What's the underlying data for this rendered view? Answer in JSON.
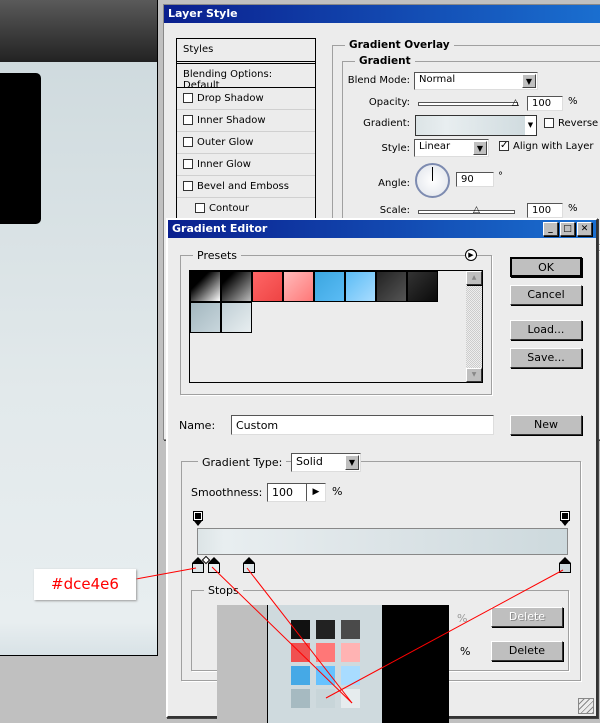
{
  "canvas": {
    "colors": {
      "top_bar": "#2a2a2a",
      "bg": "#dce4e6"
    }
  },
  "layer_style": {
    "title": "Layer Style",
    "styles_header": "Styles",
    "blending": "Blending Options: Default",
    "items": [
      {
        "label": "Drop Shadow",
        "checked": false
      },
      {
        "label": "Inner Shadow",
        "checked": false
      },
      {
        "label": "Outer Glow",
        "checked": false
      },
      {
        "label": "Inner Glow",
        "checked": false
      },
      {
        "label": "Bevel and Emboss",
        "checked": false
      },
      {
        "label": "Contour",
        "checked": false
      }
    ],
    "section": "Gradient Overlay",
    "subsection": "Gradient",
    "blend_mode_label": "Blend Mode:",
    "blend_mode": "Normal",
    "opacity_label": "Opacity:",
    "opacity": "100",
    "opacity_pct": 100,
    "pct": "%",
    "gradient_label": "Gradient:",
    "reverse_label": "Reverse",
    "reverse": false,
    "style_label": "Style:",
    "style": "Linear",
    "align_label": "Align with Layer",
    "align": true,
    "angle_label": "Angle:",
    "angle": "90",
    "deg": "°",
    "scale_label": "Scale:",
    "scale": "100",
    "scale_pct": 100
  },
  "gradient_editor": {
    "title": "Gradient Editor",
    "presets_label": "Presets",
    "presets": [
      {
        "name": "black-white",
        "bg": "linear-gradient(135deg,#000 30%,#fff)"
      },
      {
        "name": "black-transparent",
        "bg": "linear-gradient(135deg,#000 20%,#bbb)"
      },
      {
        "name": "red",
        "bg": "linear-gradient(135deg,#f66,#e44)"
      },
      {
        "name": "pink",
        "bg": "linear-gradient(135deg,#fbb,#f77)"
      },
      {
        "name": "blue",
        "bg": "linear-gradient(135deg,#3ba6e0,#5bbcf5)"
      },
      {
        "name": "light-blue",
        "bg": "linear-gradient(135deg,#5bbcf5,#a8dcff)"
      },
      {
        "name": "dark-gray",
        "bg": "linear-gradient(135deg,#222,#555)"
      },
      {
        "name": "black",
        "bg": "linear-gradient(135deg,#333,#0a0a0a)"
      },
      {
        "name": "gray-blue",
        "bg": "linear-gradient(135deg,#a3b7bf,#c8d6dc)"
      },
      {
        "name": "light-gray-blue",
        "bg": "linear-gradient(135deg,#c0cfd5,#e8eef0)"
      }
    ],
    "ok": "OK",
    "cancel": "Cancel",
    "load": "Load...",
    "save": "Save...",
    "new": "New",
    "name_label": "Name:",
    "name_value": "Custom",
    "type_label": "Gradient Type:",
    "type_value": "Solid",
    "smooth_label": "Smoothness:",
    "smooth_value": "100",
    "pct": "%",
    "stops_label": "Stops",
    "delete": "Delete",
    "gradient_colors": [
      "#dce4e6",
      "#e8eef0",
      "#dfe6e9",
      "#cdd9dd"
    ]
  },
  "annotation": {
    "color_label": "#dce4e6",
    "color": "#ff0000"
  },
  "swatch_popup": {
    "swatches": [
      "#111111",
      "#222222",
      "#4a4a4a",
      "#f05050",
      "#ff7777",
      "#ffb3b3",
      "#45a9e6",
      "#66c2ff",
      "#a8dcff",
      "#a6bac1",
      "#c8d5d9",
      "#e6ecee"
    ]
  }
}
